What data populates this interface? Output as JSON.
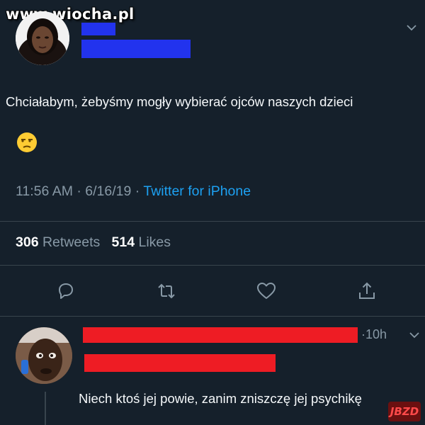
{
  "watermark": "www.wiocha.pl",
  "tweet": {
    "text": "Chciałabym, żebyśmy mogły wybierać ojców naszych dzieci",
    "emoji": "😒",
    "time": "11:56 AM",
    "date": "6/16/19",
    "separator": "·",
    "source": "Twitter for iPhone",
    "retweets_count": "306",
    "retweets_label": "Retweets",
    "likes_count": "514",
    "likes_label": "Likes"
  },
  "reply": {
    "time": "·10h",
    "text": "Niech ktoś jej powie, zanim zniszczę jej psychikę"
  },
  "badge": "JBZD",
  "icons": {
    "reply": "reply-icon",
    "retweet": "retweet-icon",
    "like": "heart-icon",
    "share": "share-icon",
    "more": "chevron-down-icon"
  },
  "colors": {
    "background": "#15202b",
    "secondary_text": "#8899a6",
    "link": "#1da1f2",
    "redaction_blue": "#2233ee",
    "redaction_red": "#ee1c24"
  }
}
